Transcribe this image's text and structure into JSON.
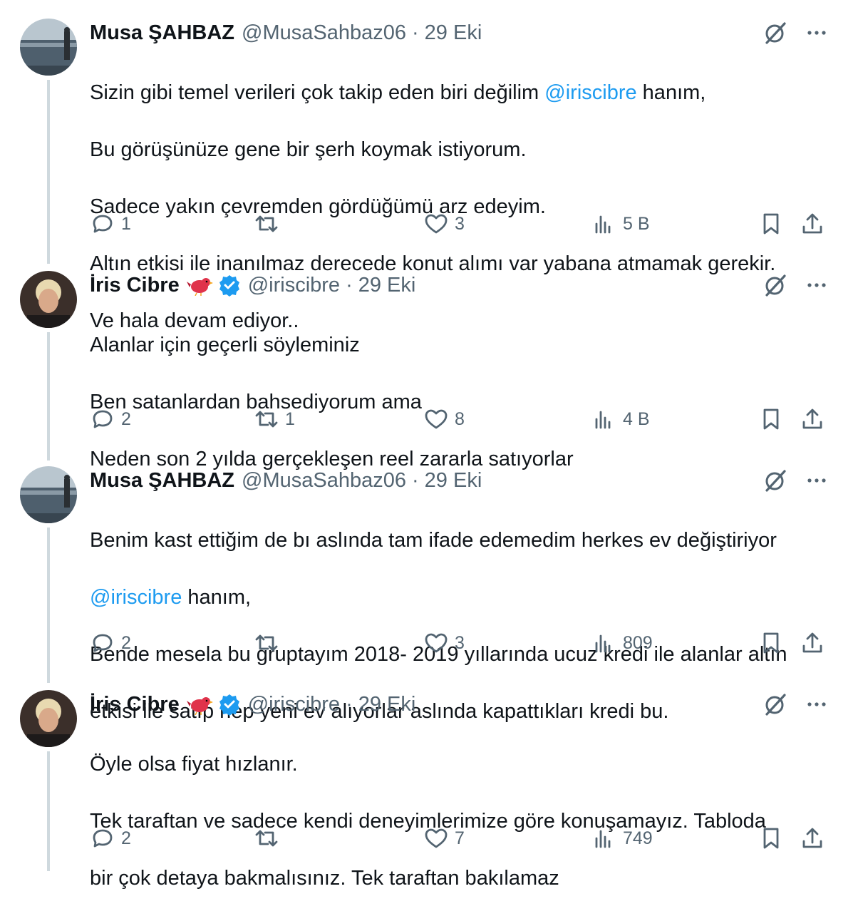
{
  "tweets": [
    {
      "name": "Musa ŞAHBAZ",
      "handle": "@MusaSahbaz06",
      "dot": "·",
      "date": "29 Eki",
      "lines": [
        {
          "before": "Sizin gibi temel verileri çok takip eden biri değilim ",
          "mention": "@iriscibre",
          "after": " hanım,"
        },
        {
          "before": "Bu görüşünüze gene bir şerh koymak istiyorum."
        },
        {
          "before": "Sadece yakın çevremden gördüğümü arz edeyim."
        },
        {
          "before": "Altın etkisi ile inanılmaz derecede konut alımı var yabana atmamak gerekir."
        },
        {
          "before": "Ve hala devam ediyor.."
        }
      ],
      "replies": "1",
      "retweets": "",
      "likes": "3",
      "views": "5 B"
    },
    {
      "name": "İris Cibre",
      "handle": "@iriscibre",
      "dot": "·",
      "date": "29 Eki",
      "lines": [
        {
          "before": "Alanlar için geçerli söyleminiz"
        },
        {
          "before": "Ben satanlardan bahsediyorum ama"
        },
        {
          "before": "Neden son 2 yılda gerçekleşen reel zararla satıyorlar"
        }
      ],
      "replies": "2",
      "retweets": "1",
      "likes": "8",
      "views": "4 B"
    },
    {
      "name": "Musa ŞAHBAZ",
      "handle": "@MusaSahbaz06",
      "dot": "·",
      "date": "29 Eki",
      "lines": [
        {
          "before": "Benim kast ettiğim de bı aslında tam ifade edemedim herkes ev değiştiriyor"
        },
        {
          "before": "",
          "mention": "@iriscibre",
          "after": " hanım,"
        },
        {
          "before": "Bende mesela bu gruptayım 2018- 2019 yıllarında ucuz kredi ile alanlar altın"
        },
        {
          "before": "etkisi ile satıp hep yeni ev alıyorlar aslında kapattıkları kredi bu."
        }
      ],
      "replies": "2",
      "retweets": "",
      "likes": "3",
      "views": "809"
    },
    {
      "name": "İris Cibre",
      "handle": "@iriscibre",
      "dot": "·",
      "date": "29 Eki",
      "lines": [
        {
          "before": "Öyle olsa fiyat hızlanır."
        },
        {
          "before": "Tek taraftan ve sadece kendi deneyimlerimize göre konuşamayız. Tabloda"
        },
        {
          "before": "bir çok detaya bakmalısınız. Tek taraftan bakılamaz"
        }
      ],
      "replies": "2",
      "retweets": "",
      "likes": "7",
      "views": "749"
    }
  ],
  "icons": {
    "grok": "grok-slash-circle-icon",
    "more": "more-dots-icon",
    "reply": "reply-bubble-icon",
    "retweet": "retweet-arrows-icon",
    "like": "heart-icon",
    "views": "views-bars-icon",
    "bookmark": "bookmark-icon",
    "share": "share-upload-icon",
    "verified": "verified-badge-icon",
    "bird": "red-bird-emoji-icon"
  },
  "colors": {
    "text": "#0f1419",
    "muted": "#536471",
    "link": "#1d9bf0",
    "line": "#cfd9de",
    "bird": "#e0334b"
  }
}
